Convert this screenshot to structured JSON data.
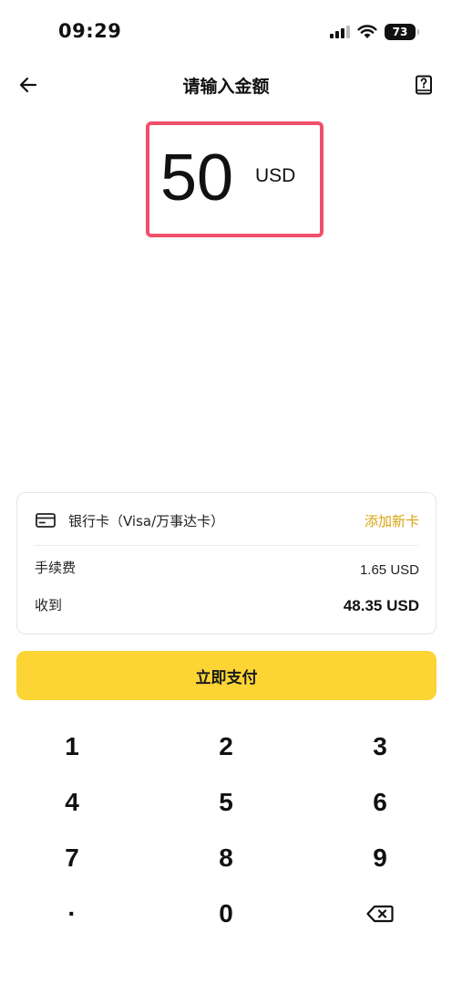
{
  "status_bar": {
    "time": "09:29",
    "battery_level": "73",
    "icons": [
      "signal-icon",
      "wifi-icon",
      "battery-icon"
    ]
  },
  "header": {
    "title": "请输入金额",
    "back_icon": "arrow-left-icon",
    "help_icon": "help-book-icon"
  },
  "amount": {
    "value": "50",
    "currency": "USD",
    "highlight_color": "#f0506a"
  },
  "payment": {
    "method_icon": "bank-card-icon",
    "method_label": "银行卡（Visa/万事达卡）",
    "add_card_label": "添加新卡",
    "add_card_color": "#d8a20e",
    "fee_label": "手续费",
    "fee_value": "1.65 USD",
    "receive_label": "收到",
    "receive_value": "48.35 USD"
  },
  "pay_button": {
    "label": "立即支付",
    "color": "#fcd535"
  },
  "keypad": {
    "keys": [
      "1",
      "2",
      "3",
      "4",
      "5",
      "6",
      "7",
      "8",
      "9",
      "·",
      "0"
    ],
    "backspace_icon": "backspace-icon"
  }
}
